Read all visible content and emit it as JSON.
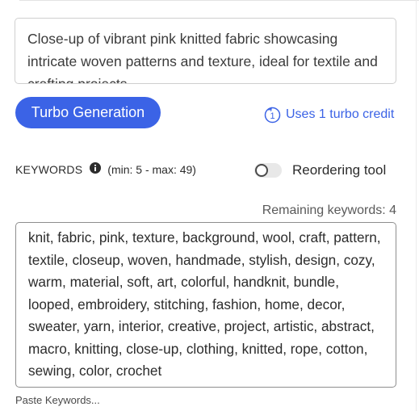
{
  "description": {
    "text": "Close-up of vibrant pink knitted fabric showcasing intricate woven patterns and texture, ideal for textile and crafting projects"
  },
  "turbo": {
    "button_label": "Turbo Generation",
    "credit_label": "Uses 1 turbo credit",
    "credit_icon": "turbo-credit-icon",
    "accent_color": "#3b63e6"
  },
  "keywords": {
    "title": "KEYWORDS",
    "info_icon": "info-icon",
    "limits": "(min: 5 - max: 49)",
    "reorder_label": "Reordering tool",
    "reorder_enabled": false,
    "remaining": "Remaining keywords: 4",
    "list": "knit, fabric, pink, texture, background, wool, craft, pattern, textile, closeup, woven, handmade, stylish, design, cozy, warm, material, soft, art, colorful, handknit, bundle, looped, embroidery, stitching, fashion, home, decor, sweater, yarn, interior, creative, project, artistic, abstract, macro, knitting, close-up, clothing, knitted, rope, cotton, sewing, color, crochet",
    "paste_label": "Paste Keywords..."
  }
}
